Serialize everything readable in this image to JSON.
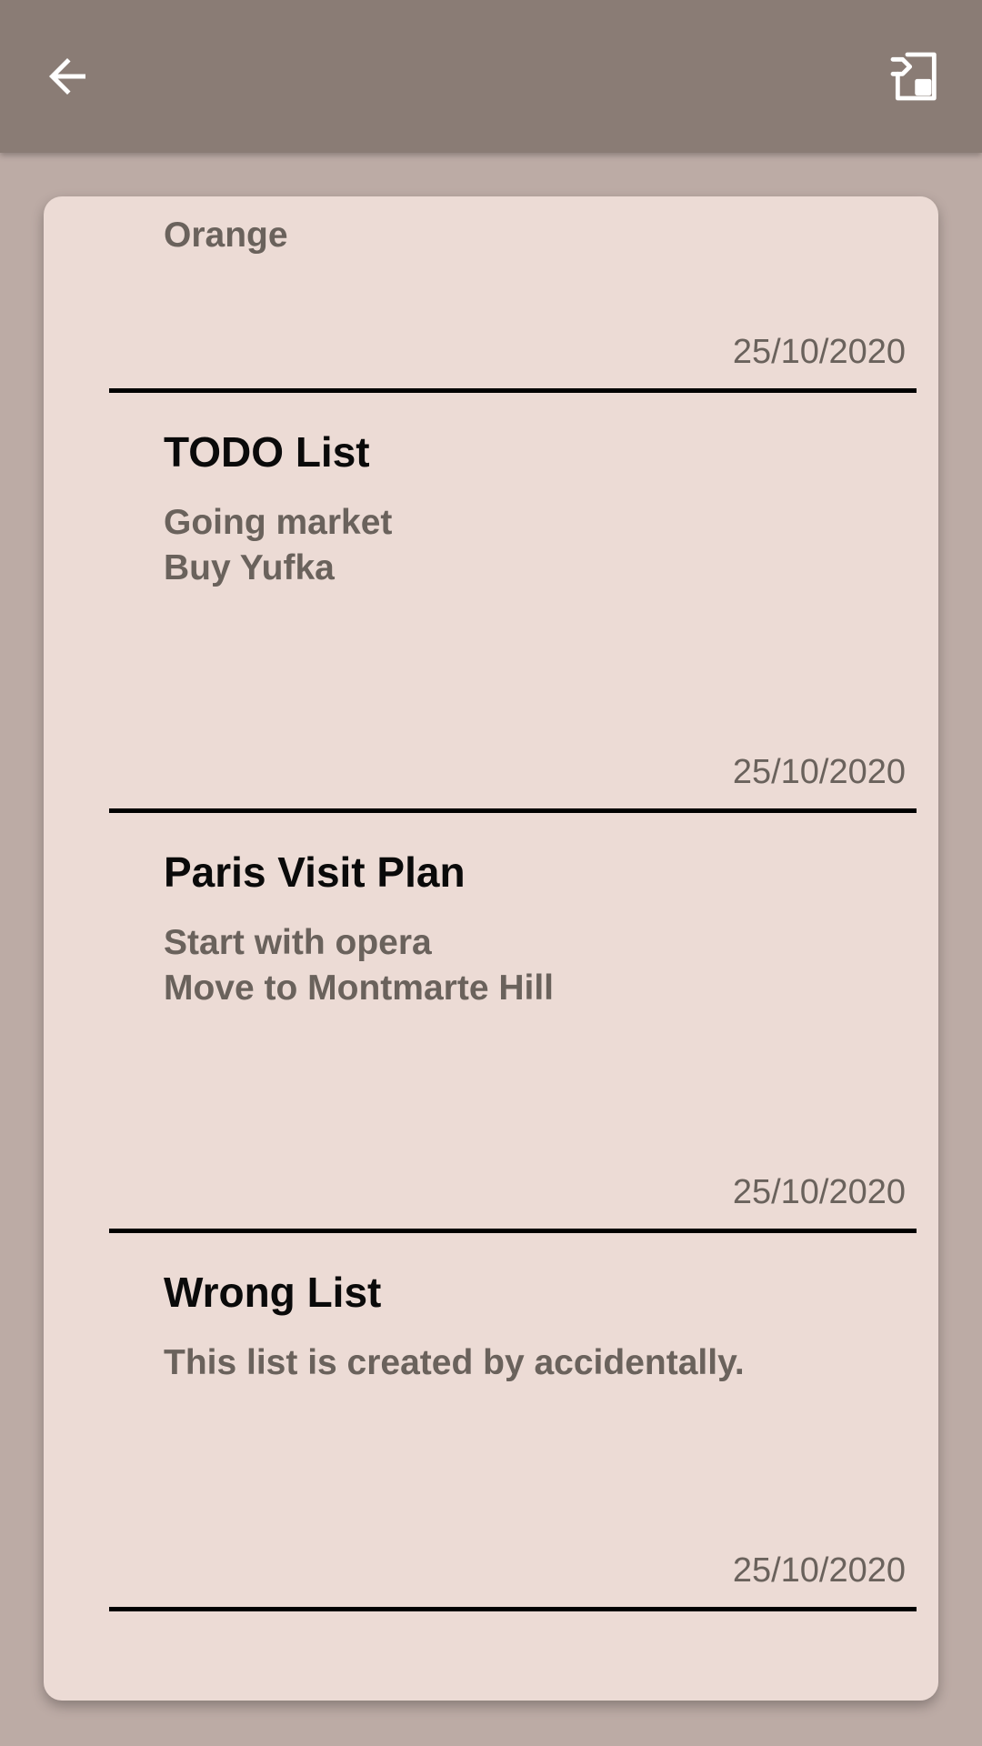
{
  "toolbar": {
    "back_icon": "arrow-left-icon",
    "export_icon": "export-file-icon",
    "bg_color": "#8a7c75"
  },
  "notes": [
    {
      "title": "",
      "body": "Orange",
      "date": "25/10/2020"
    },
    {
      "title": "TODO List",
      "body": "Going market\nBuy Yufka",
      "date": "25/10/2020"
    },
    {
      "title": "Paris Visit Plan",
      "body": "Start with opera\nMove to Montmarte Hill",
      "date": "25/10/2020"
    },
    {
      "title": "Wrong List",
      "body": "This list is created by accidentally.",
      "date": "25/10/2020"
    }
  ]
}
